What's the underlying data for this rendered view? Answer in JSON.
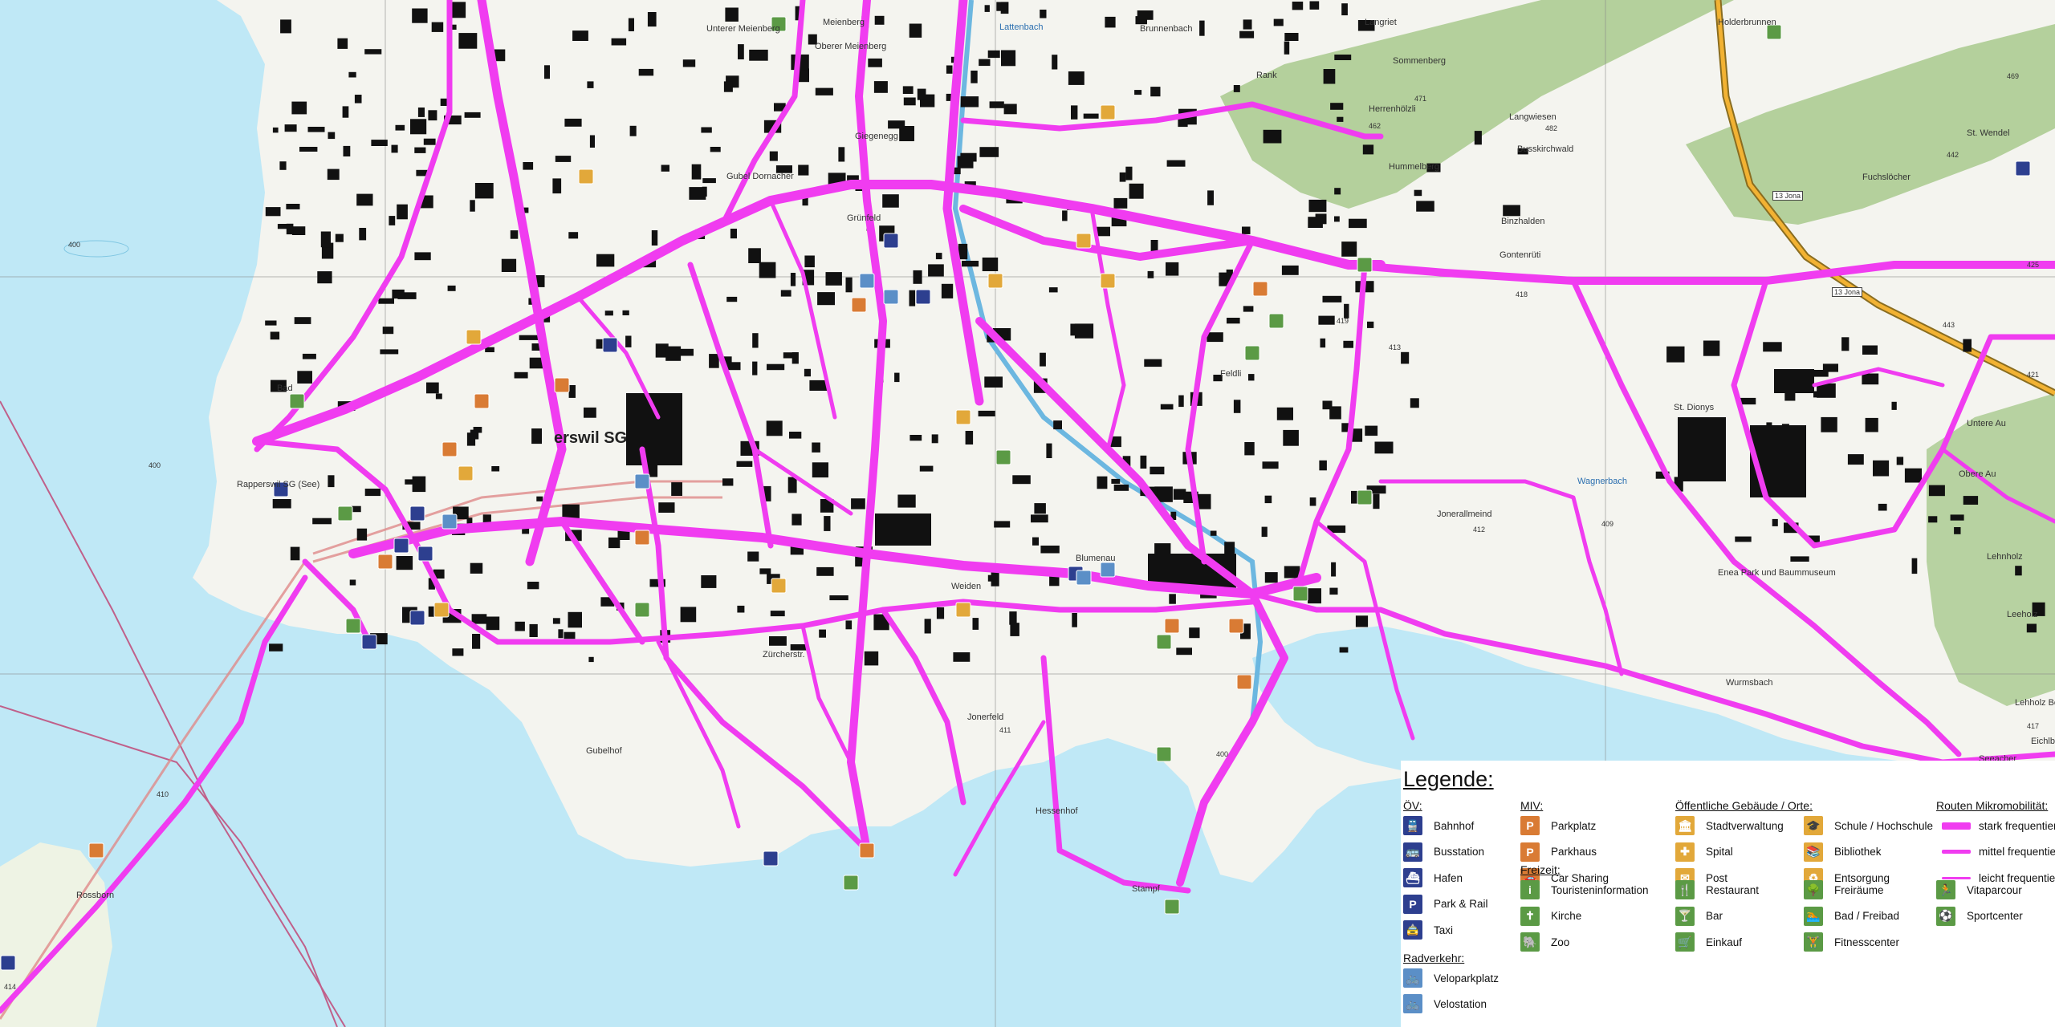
{
  "map": {
    "colors": {
      "water": "#bfe8f6",
      "land": "#f4f4ef",
      "forest": "#a8c98d",
      "building": "#111111",
      "route": "#f03cf0",
      "grid": "#8a8a8a",
      "boundary": "#c0608a"
    },
    "place_labels": [
      "Unterer Meienberg",
      "Meienberg",
      "Oberer Meienberg",
      "Lattenbach",
      "Brunnenbach",
      "Langriet",
      "Holderbrunnen",
      "Sommenberg",
      "Rank",
      "Herrenhölzli",
      "Langwiesen",
      "Hummelberg",
      "Busskirchwald",
      "St. Wendel",
      "Fuchslöcher",
      "Binzhalden",
      "Gontenrüti",
      "Giegenegg",
      "Gubel Dornacher",
      "Grünfeld",
      "Bad",
      "Rapperswil SG (See)",
      "erswil SG",
      "St. Dionys",
      "Wagnerbach",
      "Jonerallmeind",
      "Untere Au",
      "Obere Au",
      "Enea Park und Baummuseum",
      "Lehnholz",
      "Leeholz",
      "Wurmsbach",
      "Seeacher",
      "Lehholz Bollingen",
      "Eichlbach",
      "Jonerfeld",
      "Hessenhof",
      "Stampf",
      "Rossborn",
      "Weiden",
      "Blumenau",
      "Zürcherstr.",
      "Gubelhof",
      "Feldli"
    ],
    "numeric_labels": [
      "400",
      "400",
      "400",
      "418",
      "419",
      "421",
      "409",
      "410",
      "411",
      "414",
      "417",
      "413",
      "412",
      "425",
      "442",
      "471",
      "469",
      "482",
      "462",
      "443"
    ],
    "road_signs": [
      "13 Jona",
      "13 Jona"
    ]
  },
  "legend": {
    "title": "Legende:",
    "ov": {
      "title": "ÖV:",
      "items": [
        {
          "icon": "train-icon",
          "glyph": "🚆",
          "label": "Bahnhof"
        },
        {
          "icon": "bus-icon",
          "glyph": "🚌",
          "label": "Busstation"
        },
        {
          "icon": "ship-icon",
          "glyph": "⛴",
          "label": "Hafen"
        },
        {
          "icon": "park-rail-icon",
          "glyph": "P",
          "label": "Park & Rail"
        },
        {
          "icon": "taxi-icon",
          "glyph": "🚖",
          "label": "Taxi"
        }
      ]
    },
    "rad": {
      "title": "Radverkehr:",
      "items": [
        {
          "icon": "bike-parking-icon",
          "glyph": "🚲",
          "label": "Veloparkplatz"
        },
        {
          "icon": "bike-station-icon",
          "glyph": "🚲",
          "label": "Velostation"
        }
      ]
    },
    "miv": {
      "title": "MIV:",
      "items": [
        {
          "icon": "parking-icon",
          "glyph": "P",
          "label": "Parkplatz"
        },
        {
          "icon": "parking-garage-icon",
          "glyph": "P",
          "label": "Parkhaus"
        },
        {
          "icon": "car-sharing-icon",
          "glyph": "🚗",
          "label": "Car Sharing"
        }
      ]
    },
    "freizeit_a": {
      "title": "Freizeit:",
      "items": [
        {
          "icon": "tourist-info-icon",
          "glyph": "i",
          "label": "Touristeninformation"
        },
        {
          "icon": "church-icon",
          "glyph": "✝",
          "label": "Kirche"
        },
        {
          "icon": "zoo-icon",
          "glyph": "🐘",
          "label": "Zoo"
        }
      ]
    },
    "gebaeude": {
      "title": "Öffentliche Gebäude / Orte:",
      "items_left": [
        {
          "icon": "city-admin-icon",
          "glyph": "🏛",
          "label": "Stadtverwaltung"
        },
        {
          "icon": "hospital-icon",
          "glyph": "✚",
          "label": "Spital"
        },
        {
          "icon": "post-icon",
          "glyph": "✉",
          "label": "Post"
        }
      ],
      "items_right": [
        {
          "icon": "school-icon",
          "glyph": "🎓",
          "label": "Schule / Hochschule"
        },
        {
          "icon": "library-icon",
          "glyph": "📚",
          "label": "Bibliothek"
        },
        {
          "icon": "disposal-icon",
          "glyph": "♻",
          "label": "Entsorgung"
        }
      ]
    },
    "freizeit_b": {
      "items_left": [
        {
          "icon": "restaurant-icon",
          "glyph": "🍴",
          "label": "Restaurant"
        },
        {
          "icon": "bar-icon",
          "glyph": "🍸",
          "label": "Bar"
        },
        {
          "icon": "shopping-icon",
          "glyph": "🛒",
          "label": "Einkauf"
        }
      ],
      "items_mid": [
        {
          "icon": "open-space-icon",
          "glyph": "🌳",
          "label": "Freiräume"
        },
        {
          "icon": "swimming-icon",
          "glyph": "🏊",
          "label": "Bad / Freibad"
        },
        {
          "icon": "fitness-icon",
          "glyph": "🏋",
          "label": "Fitnesscenter"
        }
      ],
      "items_right": [
        {
          "icon": "vitaparcour-icon",
          "glyph": "🏃",
          "label": "Vitaparcour"
        },
        {
          "icon": "sports-center-icon",
          "glyph": "⚽",
          "label": "Sportcenter"
        }
      ]
    },
    "routen": {
      "title": "Routen Mikromobilität:",
      "items": [
        {
          "label": "stark frequentiert",
          "level": "strong"
        },
        {
          "label": "mittel frequentiert",
          "level": "medium"
        },
        {
          "label": "leicht frequentiert",
          "level": "light"
        }
      ]
    }
  }
}
